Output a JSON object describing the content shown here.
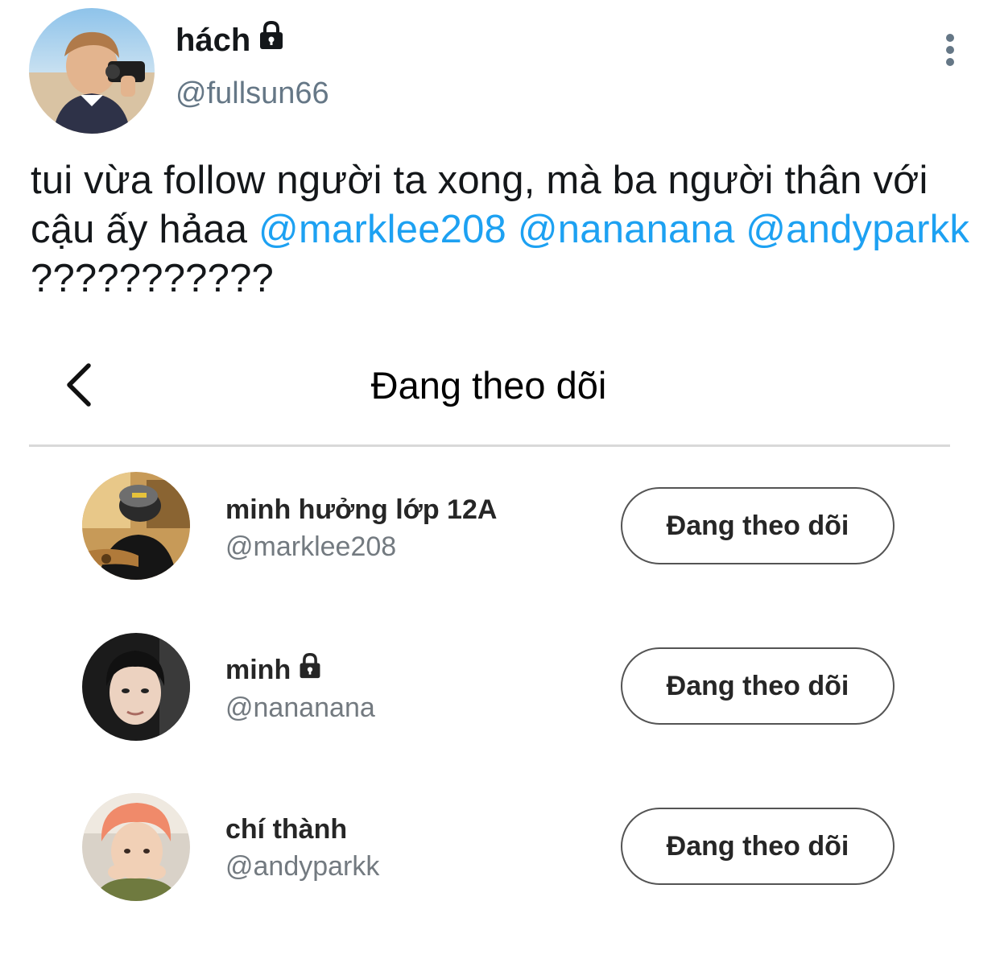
{
  "tweet": {
    "author_name": "hách",
    "author_handle": "@fullsun66",
    "author_locked": true,
    "text_intro": "tui vừa follow người ta xong, mà ba người thân với cậu ấy hảaa",
    "mentions": [
      "@marklee208",
      "@nananana",
      "@andyparkk"
    ],
    "text_outro": "???????????"
  },
  "following_screen": {
    "title": "Đang theo dõi",
    "users": [
      {
        "name": "minh hưởng lớp 12A",
        "handle": "@marklee208",
        "locked": false,
        "button_label": "Đang theo dõi"
      },
      {
        "name": "minh",
        "handle": "@nananana",
        "locked": true,
        "button_label": "Đang theo dõi"
      },
      {
        "name": "chí thành",
        "handle": "@andyparkk",
        "locked": false,
        "button_label": "Đang theo dõi"
      }
    ]
  },
  "colors": {
    "mention": "#1da1f2",
    "handle_gray": "#657786",
    "text": "#14171a"
  }
}
